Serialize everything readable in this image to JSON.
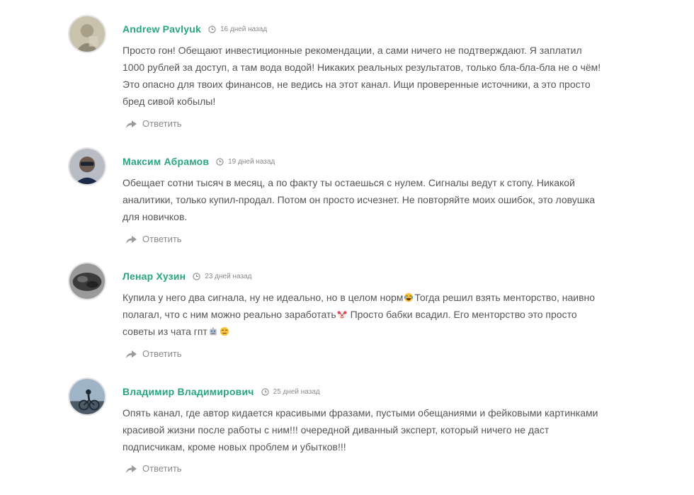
{
  "reply_label": "Ответить",
  "colors": {
    "author": "#2aa581",
    "text": "#555555",
    "meta": "#8a8a8a"
  },
  "comments": [
    {
      "author": "Andrew Pavlyuk",
      "date": "16 дней назад",
      "text": "Просто гон! Обещают инвестиционные рекомендации, а сами ничего не подтверждают. Я заплатил 1000 рублей за доступ, а там вода водой! Никаких реальных результатов, только бла-бла-бла не о чём! Это опасно для твоих финансов, не ведись на этот канал. Ищи проверенные источники, а это просто бред сивой кобылы!"
    },
    {
      "author": "Максим Абрамов",
      "date": "19 дней назад",
      "text": "Обещает сотни тысяч в месяц, а по факту ты остаешься с нулем. Сигналы ведут к стопу. Никакой аналитики, только купил-продал. Потом он просто исчезнет. Не повторяйте моих ошибок, это ловушка для новичков."
    },
    {
      "author": "Ленар Хузин",
      "date": "23 дней назад",
      "text_part1": "Купила у него два сигнала, ну не идеально, но в целом норм",
      "emoji1": "laughing-crying-emoji",
      "text_part2": "Тогда решил взять менторство, наивно полагал, что с ним можно реально заработать",
      "emoji2": "clown-emoji",
      "text_part3": " Просто бабки всадил. Его менторство это просто советы из чата гпт",
      "emoji3": "robot-emoji",
      "emoji4": "unamused-face-emoji"
    },
    {
      "author": "Владимир Владимирович",
      "date": "25 дней назад",
      "text": "Опять канал, где автор кидается красивыми фразами, пустыми обещаниями и фейковыми картинками красивой жизни после работы с ним!!! очередной диванный эксперт, который ничего не даст подписчикам, кроме новых проблем и убытков!!!"
    }
  ]
}
